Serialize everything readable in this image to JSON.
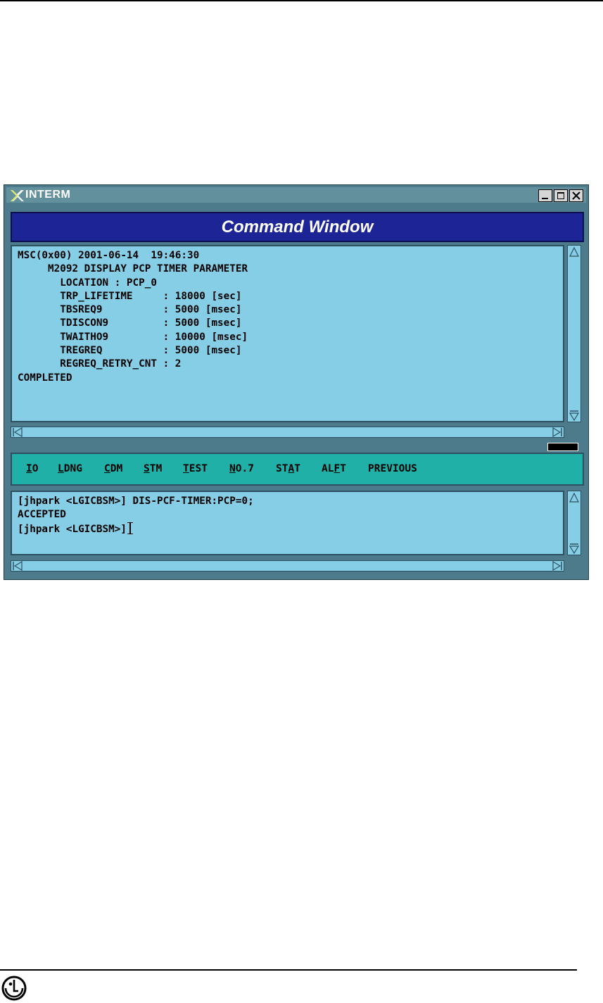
{
  "window": {
    "title": "INTERM",
    "header": "Command Window",
    "controls": [
      "minimize",
      "maximize",
      "close"
    ]
  },
  "output": {
    "lines": [
      "MSC(0x00) 2001-06-14  19:46:30",
      "     M2092 DISPLAY PCP TIMER PARAMETER",
      "       LOCATION : PCP_0",
      "       TRP_LIFETIME     : 18000 [sec]",
      "       TBSREQ9          : 5000 [msec]",
      "       TDISCON9         : 5000 [msec]",
      "       TWAITHO9         : 10000 [msec]",
      "       TREGREQ          : 5000 [msec]",
      "       REGREQ_RETRY_CNT : 2",
      "COMPLETED"
    ]
  },
  "menu": {
    "items": [
      {
        "label": "IO",
        "underline": 0
      },
      {
        "label": "LDNG",
        "underline": 0
      },
      {
        "label": "CDM",
        "underline": 0
      },
      {
        "label": "STM",
        "underline": 0
      },
      {
        "label": "TEST",
        "underline": 0
      },
      {
        "label": "NO.7",
        "underline": 0
      },
      {
        "label": "STAT",
        "underline": 2
      },
      {
        "label": "ALFT",
        "underline": 2
      },
      {
        "label": "PREVIOUS",
        "underline": -1
      }
    ]
  },
  "input": {
    "lines": [
      "[jhpark <LGICBSM>] DIS-PCF-TIMER:PCP=0;",
      "ACCEPTED",
      "[jhpark <LGICBSM>]"
    ]
  },
  "colors": {
    "pane_bg": "#86cde6",
    "menubar_bg": "#20b0a8",
    "header_bg": "#1c2496",
    "frame": "#4e7b8c"
  },
  "icons": [
    "x-logo-icon",
    "lg-logo-icon"
  ]
}
